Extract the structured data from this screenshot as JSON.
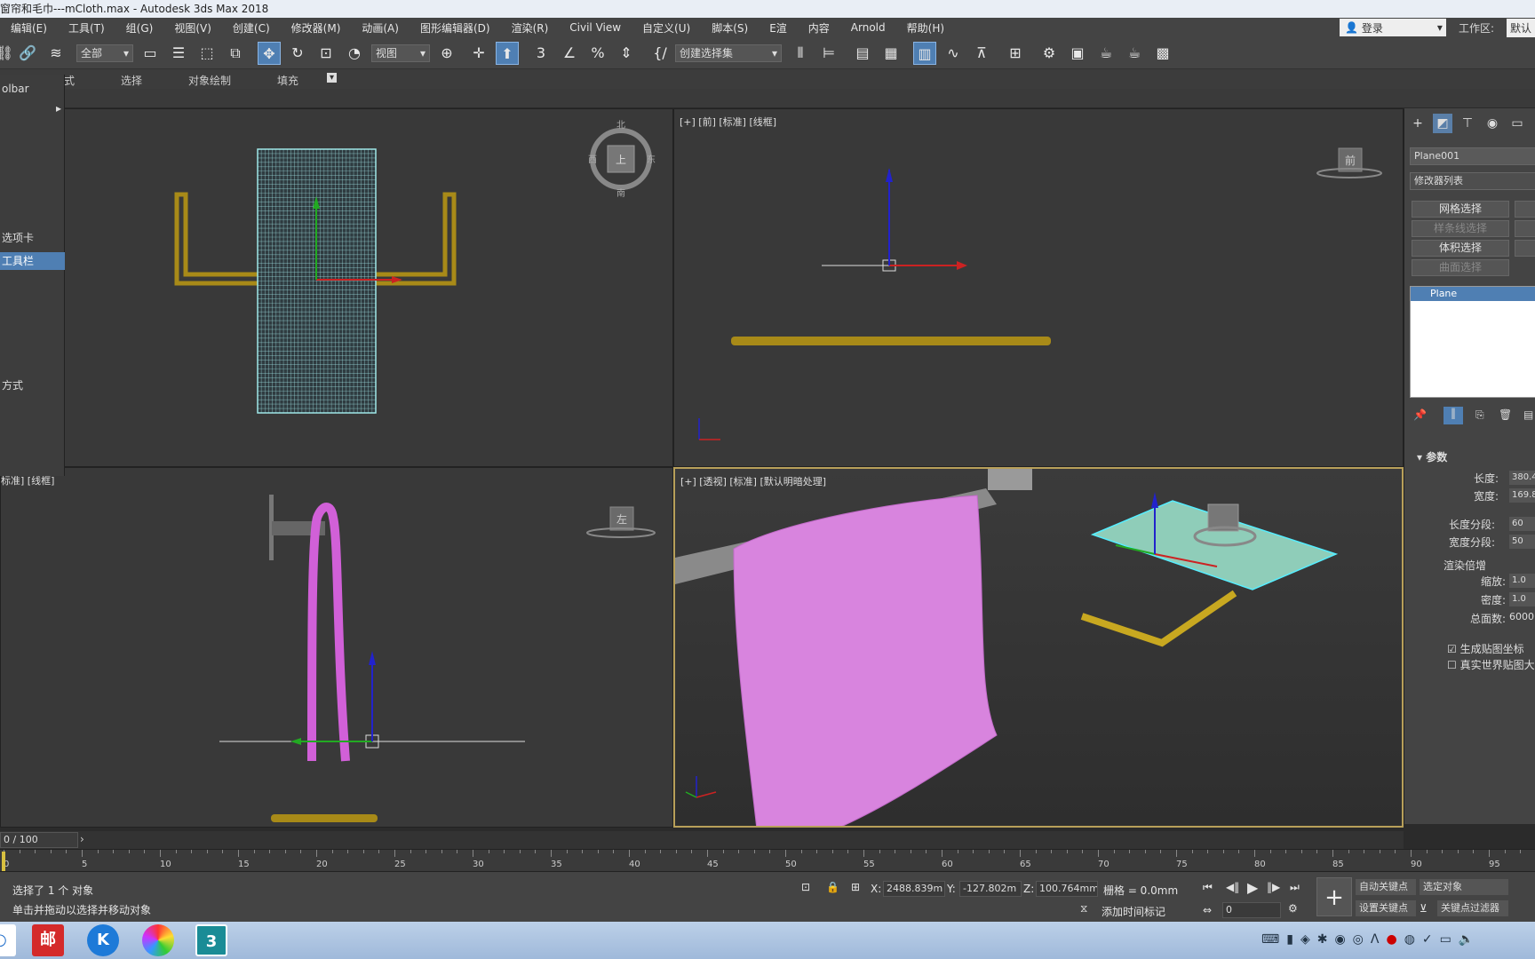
{
  "title": "窗帘和毛巾---mCloth.max - Autodesk 3ds Max 2018",
  "menu": [
    "编辑(E)",
    "工具(T)",
    "组(G)",
    "视图(V)",
    "创建(C)",
    "修改器(M)",
    "动画(A)",
    "图形编辑器(D)",
    "渲染(R)",
    "Civil View",
    "自定义(U)",
    "脚本(S)",
    "E渲",
    "内容",
    "Arnold",
    "帮助(H)"
  ],
  "login_label": "登录",
  "workspace_label": "工作区:",
  "workspace_value": "默认",
  "toolbar": {
    "filter_value": "全部",
    "refcoord_value": "视图",
    "named_selection_placeholder": "创建选择集"
  },
  "ribbon": [
    "式",
    "选择",
    "对象绘制",
    "填充"
  ],
  "leftmenu": [
    "olbar",
    "",
    "选项卡",
    "工具栏",
    "方式"
  ],
  "viewports": {
    "top_left_label": "",
    "top_right_label": "[+] [前] [标准] [线框]",
    "bottom_left_label": "标准] [线框]",
    "bottom_right_label": "[+] [透视] [标准] [默认明暗处理]",
    "viewcube_front": "前",
    "viewcube_left": "左",
    "viewcube_top": "上",
    "compass_n": "北",
    "compass_s": "南",
    "compass_e": "东",
    "compass_w": "西"
  },
  "command_panel": {
    "object_name": "Plane001",
    "modifier_list": "修改器列表",
    "buttons": [
      "网格选择",
      "样条线选择",
      "体积选择",
      "曲面选择"
    ],
    "stack_item": "Plane",
    "params_title": "参数",
    "length_label": "长度:",
    "length_value": "380.4",
    "width_label": "宽度:",
    "width_value": "169.8",
    "length_segs_label": "长度分段:",
    "length_segs_value": "60",
    "width_segs_label": "宽度分段:",
    "width_segs_value": "50",
    "render_mult_label": "渲染倍增",
    "scale_label": "缩放:",
    "scale_value": "1.0",
    "density_label": "密度:",
    "density_value": "1.0",
    "total_faces_label": "总面数:",
    "total_faces_value": "6000",
    "gen_uv_label": "生成贴图坐标",
    "real_world_label": "真实世界贴图大小"
  },
  "timeline": {
    "frame_display": "0 / 100",
    "ticks": [
      "0",
      "5",
      "10",
      "15",
      "20",
      "25",
      "30",
      "35",
      "40",
      "45",
      "50",
      "55",
      "60",
      "65",
      "70",
      "75",
      "80",
      "85",
      "90",
      "95"
    ]
  },
  "status": {
    "selected": "选择了 1 个 对象",
    "prompt": "单击并拖动以选择并移动对象",
    "x_label": "X:",
    "x_value": "2488.839m",
    "y_label": "Y:",
    "y_value": "-127.802m",
    "z_label": "Z:",
    "z_value": "100.764mm",
    "grid": "栅格 = 0.0mm",
    "add_time_tag": "添加时间标记",
    "auto_key": "自动关键点",
    "set_key": "设置关键点",
    "selected_object": "选定对象",
    "key_filter": "关键点过滤器",
    "frame_value": "0"
  },
  "taskbar_apps": [
    "邮",
    "K",
    "",
    "3"
  ],
  "colors": {
    "accent": "#4f7fb3",
    "cloth": "#d884de",
    "rail": "#b89a20",
    "selected_plane": "#9fe8d0"
  }
}
